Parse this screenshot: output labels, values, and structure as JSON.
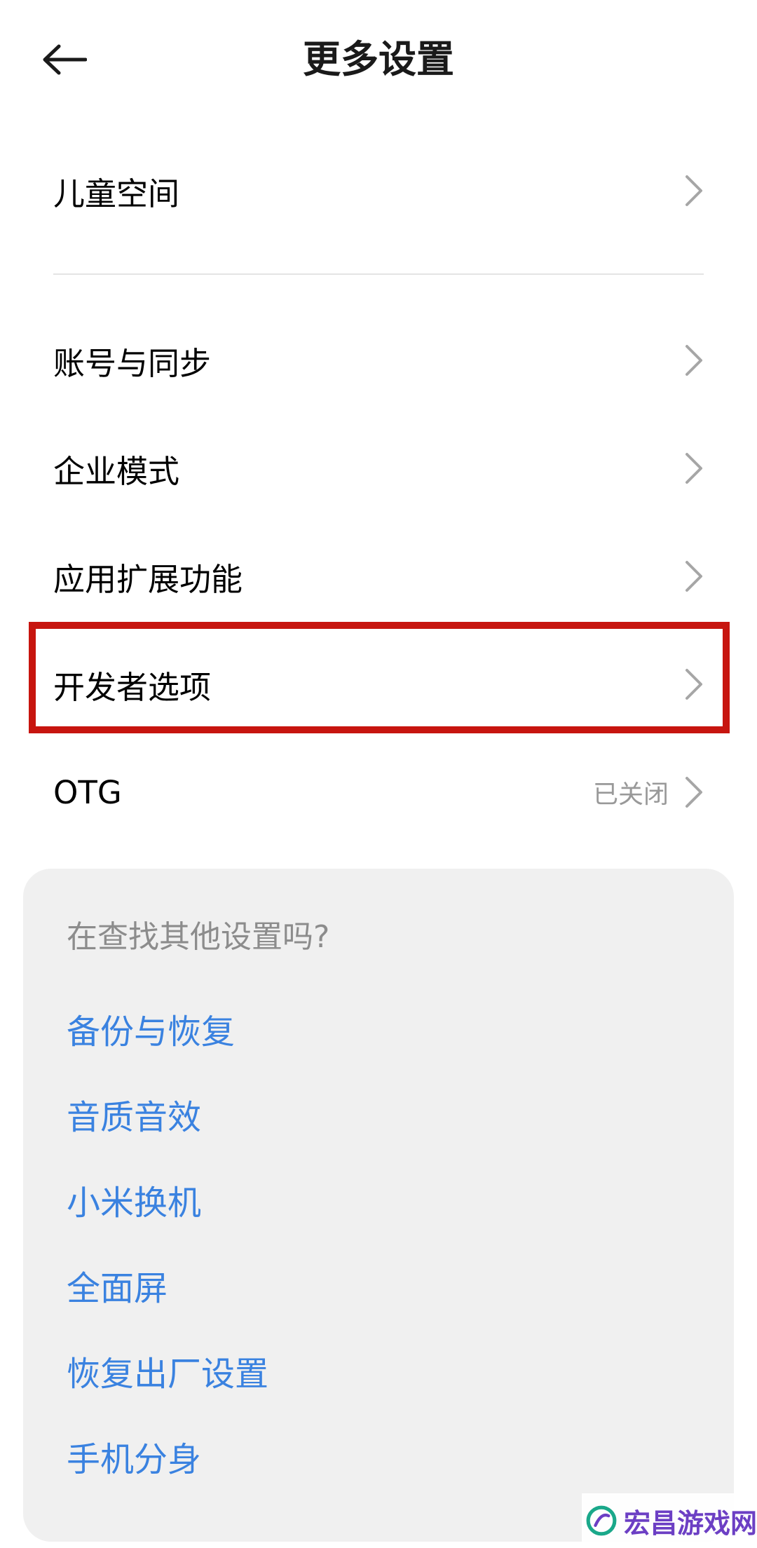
{
  "header": {
    "title": "更多设置"
  },
  "rows": {
    "children_space": "儿童空间",
    "account_sync": "账号与同步",
    "enterprise_mode": "企业模式",
    "app_extensions": "应用扩展功能",
    "developer_options": "开发者选项",
    "otg": "OTG",
    "otg_value": "已关闭"
  },
  "search_card": {
    "title": "在查找其他设置吗?",
    "links": [
      "备份与恢复",
      "音质音效",
      "小米换机",
      "全面屏",
      "恢复出厂设置",
      "手机分身"
    ]
  },
  "watermark": {
    "text": "宏昌游戏网"
  },
  "colors": {
    "highlight": "#c7150f",
    "link": "#3a82e0",
    "card_bg": "#f0f0f0",
    "muted_text": "#999999"
  },
  "icons": {
    "back": "arrow-left-icon",
    "chevron": "chevron-right-icon"
  }
}
